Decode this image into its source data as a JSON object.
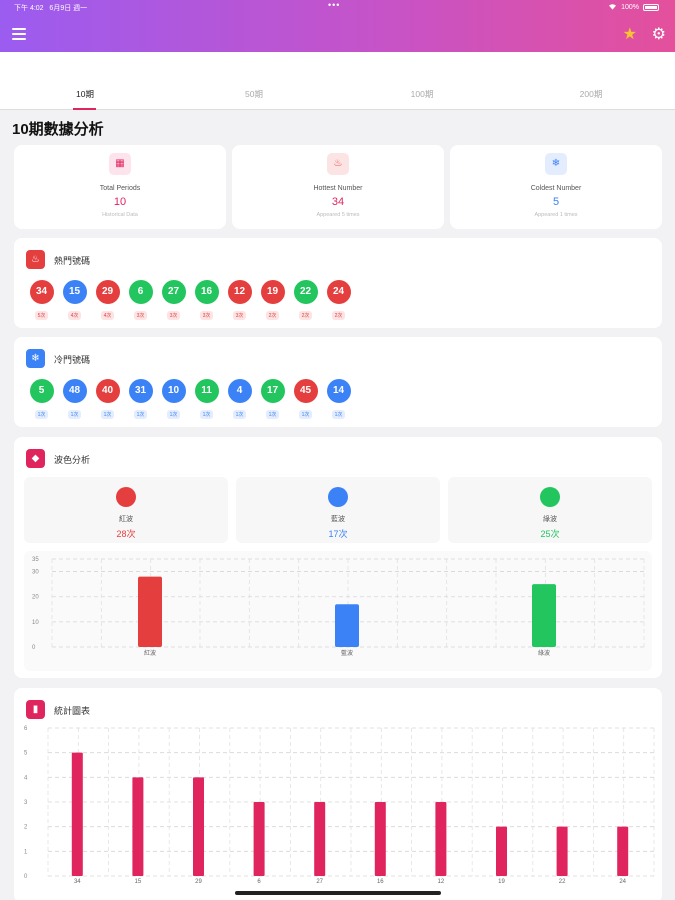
{
  "status_bar": {
    "time": "下午 4:02",
    "date": "6月9日 週一",
    "battery": "100%"
  },
  "tabs": [
    {
      "label": "10期",
      "active": true
    },
    {
      "label": "50期",
      "active": false
    },
    {
      "label": "100期",
      "active": false
    },
    {
      "label": "200期",
      "active": false
    }
  ],
  "page_title": "10期數據分析",
  "stats": [
    {
      "label": "Total Periods",
      "value": "10",
      "sub": "Historical Data",
      "value_color": "#e0245e",
      "icon": "calendar-icon"
    },
    {
      "label": "Hottest Number",
      "value": "34",
      "sub": "Appeared 5 times",
      "value_color": "#e0245e",
      "icon": "fire-icon"
    },
    {
      "label": "Coldest Number",
      "value": "5",
      "sub": "Appeared 1 times",
      "value_color": "#3b82f6",
      "icon": "snowflake-icon"
    }
  ],
  "hot": {
    "title": "熱門號碼",
    "balls": [
      {
        "n": "34",
        "c": "#e53e3e",
        "badge": "5次"
      },
      {
        "n": "15",
        "c": "#3b82f6",
        "badge": "4次"
      },
      {
        "n": "29",
        "c": "#e53e3e",
        "badge": "4次"
      },
      {
        "n": "6",
        "c": "#22c55e",
        "badge": "3次"
      },
      {
        "n": "27",
        "c": "#22c55e",
        "badge": "3次"
      },
      {
        "n": "16",
        "c": "#22c55e",
        "badge": "3次"
      },
      {
        "n": "12",
        "c": "#e53e3e",
        "badge": "3次"
      },
      {
        "n": "19",
        "c": "#e53e3e",
        "badge": "2次"
      },
      {
        "n": "22",
        "c": "#22c55e",
        "badge": "2次"
      },
      {
        "n": "24",
        "c": "#e53e3e",
        "badge": "2次"
      }
    ]
  },
  "cold": {
    "title": "冷門號碼",
    "balls": [
      {
        "n": "5",
        "c": "#22c55e",
        "badge": "1次"
      },
      {
        "n": "48",
        "c": "#3b82f6",
        "badge": "1次"
      },
      {
        "n": "40",
        "c": "#e53e3e",
        "badge": "1次"
      },
      {
        "n": "31",
        "c": "#3b82f6",
        "badge": "1次"
      },
      {
        "n": "10",
        "c": "#3b82f6",
        "badge": "1次"
      },
      {
        "n": "11",
        "c": "#22c55e",
        "badge": "1次"
      },
      {
        "n": "4",
        "c": "#3b82f6",
        "badge": "1次"
      },
      {
        "n": "17",
        "c": "#22c55e",
        "badge": "1次"
      },
      {
        "n": "45",
        "c": "#e53e3e",
        "badge": "1次"
      },
      {
        "n": "14",
        "c": "#3b82f6",
        "badge": "1次"
      }
    ]
  },
  "wave": {
    "title": "波色分析",
    "items": [
      {
        "name": "紅波",
        "count": "28次",
        "color": "#e53e3e"
      },
      {
        "name": "藍波",
        "count": "17次",
        "color": "#3b82f6"
      },
      {
        "name": "綠波",
        "count": "25次",
        "color": "#22c55e"
      }
    ]
  },
  "stat_chart": {
    "title": "統計圖表"
  },
  "chart_data": [
    {
      "type": "bar",
      "categories": [
        "紅波",
        "藍波",
        "綠波"
      ],
      "values": [
        28,
        17,
        25
      ],
      "colors": [
        "#e53e3e",
        "#3b82f6",
        "#22c55e"
      ],
      "yticks": [
        "35",
        "30",
        "20",
        "10",
        "0"
      ],
      "ylim": [
        0,
        35
      ],
      "grid": true
    },
    {
      "type": "bar",
      "categories": [
        "34",
        "15",
        "29",
        "6",
        "27",
        "16",
        "12",
        "19",
        "22",
        "24"
      ],
      "values": [
        5,
        4,
        4,
        3,
        3,
        3,
        3,
        2,
        2,
        2
      ],
      "color": "#e0245e",
      "yticks": [
        "6",
        "5",
        "4",
        "3",
        "2",
        "1",
        "0"
      ],
      "ylim": [
        0,
        6
      ],
      "grid": true
    }
  ]
}
